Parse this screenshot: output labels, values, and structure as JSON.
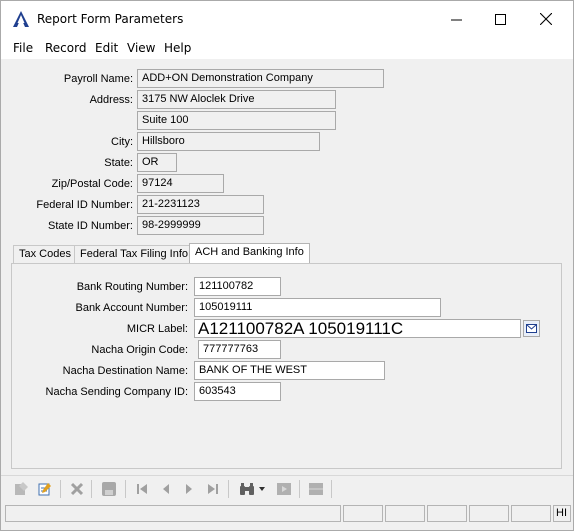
{
  "window": {
    "title": "Report Form Parameters"
  },
  "menu": [
    "File",
    "Record",
    "Edit",
    "View",
    "Help"
  ],
  "fields": {
    "payroll_name": {
      "label": "Payroll Name:",
      "value": "ADD+ON Demonstration Company"
    },
    "address": {
      "label": "Address:",
      "value": "3175 NW Aloclek Drive"
    },
    "address2": {
      "value": "Suite 100"
    },
    "city": {
      "label": "City:",
      "value": "Hillsboro"
    },
    "state": {
      "label": "State:",
      "value": "OR"
    },
    "zip": {
      "label": "Zip/Postal Code:",
      "value": "97124"
    },
    "federal_id": {
      "label": "Federal ID Number:",
      "value": "21-2231123"
    },
    "state_id": {
      "label": "State ID Number:",
      "value": "98-2999999"
    }
  },
  "tabs": [
    "Tax Codes",
    "Federal Tax Filing Info",
    "ACH and Banking Info"
  ],
  "active_tab": "ACH and Banking Info",
  "banking": {
    "routing": {
      "label": "Bank Routing Number:",
      "value": "121100782"
    },
    "account": {
      "label": "Bank Account Number:",
      "value": "105019111"
    },
    "micr": {
      "label": "MICR Label:",
      "value": "A121100782A 105019111C"
    },
    "origin": {
      "label": "Nacha Origin Code:",
      "value": "777777763"
    },
    "destination": {
      "label": "Nacha Destination Name:",
      "value": "BANK OF THE WEST"
    },
    "sending_id": {
      "label": "Nacha Sending Company ID:",
      "value": "603543"
    }
  },
  "status": {
    "last_cell": "HI"
  },
  "colors": {
    "accent": "#1f3f8f",
    "disabled_icon": "#a0a0a0"
  }
}
